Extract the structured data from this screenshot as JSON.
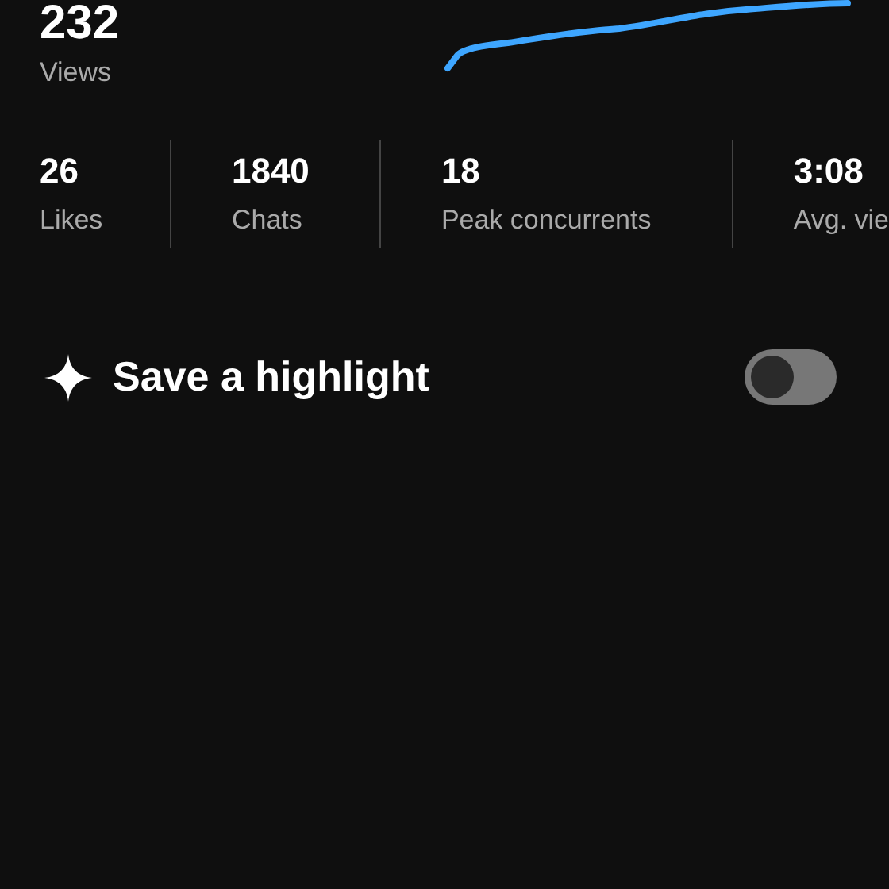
{
  "summary": {
    "value": "232",
    "label": "Views"
  },
  "stats": [
    {
      "value": "26",
      "label": "Likes"
    },
    {
      "value": "1840",
      "label": "Chats"
    },
    {
      "value": "18",
      "label": "Peak concurrents"
    },
    {
      "value": "3:08",
      "label": "Avg. vie"
    }
  ],
  "highlight": {
    "label": "Save a highlight",
    "on": false
  }
}
